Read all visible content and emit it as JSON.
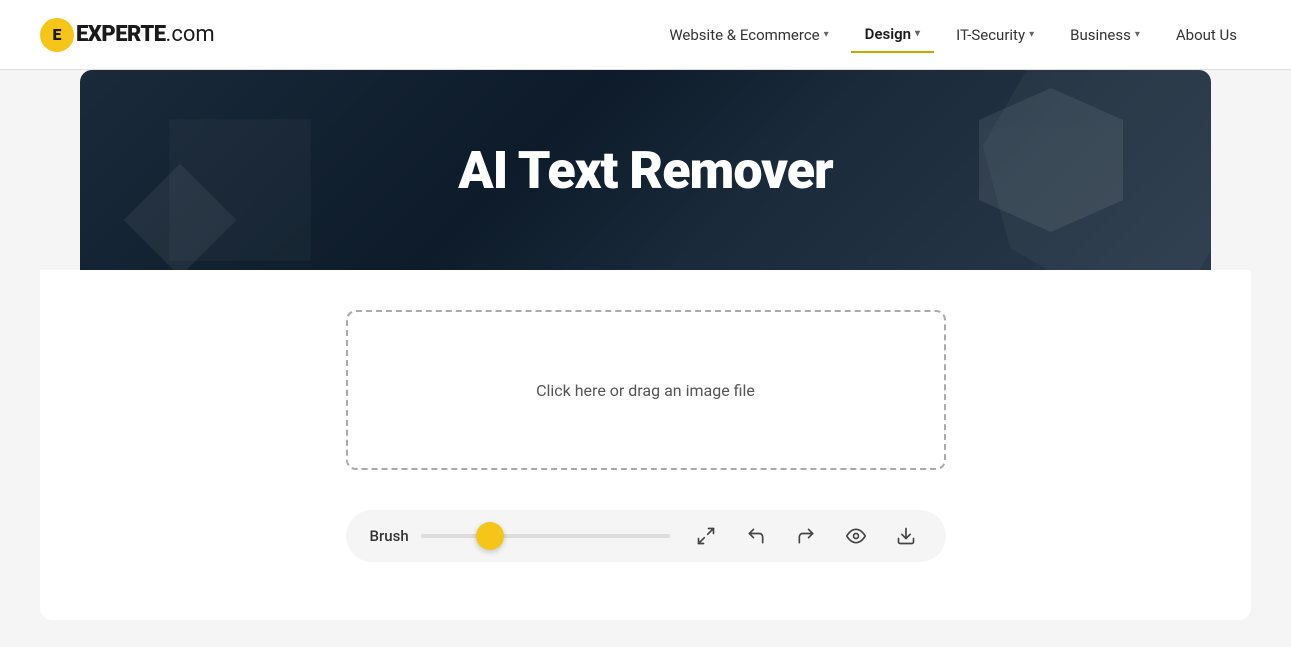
{
  "logo": {
    "icon_letter": "E",
    "brand": "EXPERTE",
    "domain": ".com"
  },
  "nav": {
    "items": [
      {
        "id": "website-ecommerce",
        "label": "Website & Ecommerce",
        "has_dropdown": true,
        "active": false
      },
      {
        "id": "design",
        "label": "Design",
        "has_dropdown": true,
        "active": true
      },
      {
        "id": "it-security",
        "label": "IT-Security",
        "has_dropdown": true,
        "active": false
      },
      {
        "id": "business",
        "label": "Business",
        "has_dropdown": true,
        "active": false
      }
    ],
    "about_label": "About Us"
  },
  "hero": {
    "title": "AI Text Remover"
  },
  "main": {
    "dropzone_text": "Click here or drag an image file"
  },
  "toolbar": {
    "brush_label": "Brush",
    "slider_value": 28,
    "icons": {
      "expand": "expand",
      "undo": "undo",
      "redo": "redo",
      "eye": "eye",
      "download": "download"
    }
  }
}
